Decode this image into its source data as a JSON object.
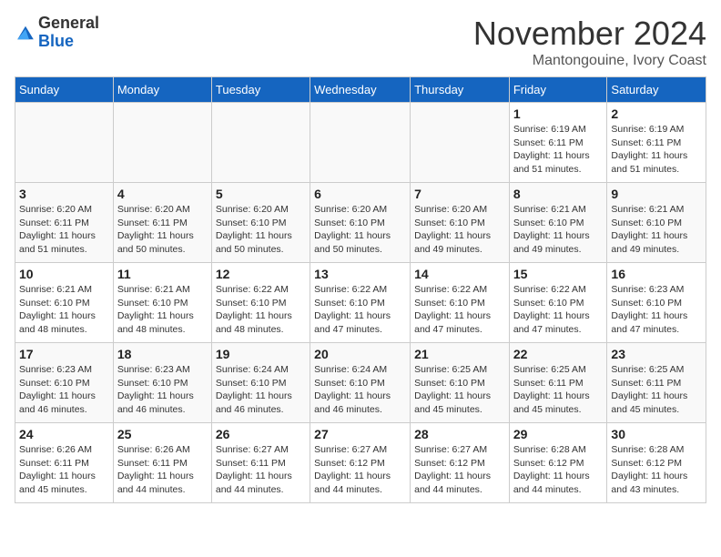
{
  "logo": {
    "general": "General",
    "blue": "Blue"
  },
  "title": "November 2024",
  "location": "Mantongouine, Ivory Coast",
  "weekdays": [
    "Sunday",
    "Monday",
    "Tuesday",
    "Wednesday",
    "Thursday",
    "Friday",
    "Saturday"
  ],
  "weeks": [
    [
      {
        "day": "",
        "info": ""
      },
      {
        "day": "",
        "info": ""
      },
      {
        "day": "",
        "info": ""
      },
      {
        "day": "",
        "info": ""
      },
      {
        "day": "",
        "info": ""
      },
      {
        "day": "1",
        "info": "Sunrise: 6:19 AM\nSunset: 6:11 PM\nDaylight: 11 hours and 51 minutes."
      },
      {
        "day": "2",
        "info": "Sunrise: 6:19 AM\nSunset: 6:11 PM\nDaylight: 11 hours and 51 minutes."
      }
    ],
    [
      {
        "day": "3",
        "info": "Sunrise: 6:20 AM\nSunset: 6:11 PM\nDaylight: 11 hours and 51 minutes."
      },
      {
        "day": "4",
        "info": "Sunrise: 6:20 AM\nSunset: 6:11 PM\nDaylight: 11 hours and 50 minutes."
      },
      {
        "day": "5",
        "info": "Sunrise: 6:20 AM\nSunset: 6:10 PM\nDaylight: 11 hours and 50 minutes."
      },
      {
        "day": "6",
        "info": "Sunrise: 6:20 AM\nSunset: 6:10 PM\nDaylight: 11 hours and 50 minutes."
      },
      {
        "day": "7",
        "info": "Sunrise: 6:20 AM\nSunset: 6:10 PM\nDaylight: 11 hours and 49 minutes."
      },
      {
        "day": "8",
        "info": "Sunrise: 6:21 AM\nSunset: 6:10 PM\nDaylight: 11 hours and 49 minutes."
      },
      {
        "day": "9",
        "info": "Sunrise: 6:21 AM\nSunset: 6:10 PM\nDaylight: 11 hours and 49 minutes."
      }
    ],
    [
      {
        "day": "10",
        "info": "Sunrise: 6:21 AM\nSunset: 6:10 PM\nDaylight: 11 hours and 48 minutes."
      },
      {
        "day": "11",
        "info": "Sunrise: 6:21 AM\nSunset: 6:10 PM\nDaylight: 11 hours and 48 minutes."
      },
      {
        "day": "12",
        "info": "Sunrise: 6:22 AM\nSunset: 6:10 PM\nDaylight: 11 hours and 48 minutes."
      },
      {
        "day": "13",
        "info": "Sunrise: 6:22 AM\nSunset: 6:10 PM\nDaylight: 11 hours and 47 minutes."
      },
      {
        "day": "14",
        "info": "Sunrise: 6:22 AM\nSunset: 6:10 PM\nDaylight: 11 hours and 47 minutes."
      },
      {
        "day": "15",
        "info": "Sunrise: 6:22 AM\nSunset: 6:10 PM\nDaylight: 11 hours and 47 minutes."
      },
      {
        "day": "16",
        "info": "Sunrise: 6:23 AM\nSunset: 6:10 PM\nDaylight: 11 hours and 47 minutes."
      }
    ],
    [
      {
        "day": "17",
        "info": "Sunrise: 6:23 AM\nSunset: 6:10 PM\nDaylight: 11 hours and 46 minutes."
      },
      {
        "day": "18",
        "info": "Sunrise: 6:23 AM\nSunset: 6:10 PM\nDaylight: 11 hours and 46 minutes."
      },
      {
        "day": "19",
        "info": "Sunrise: 6:24 AM\nSunset: 6:10 PM\nDaylight: 11 hours and 46 minutes."
      },
      {
        "day": "20",
        "info": "Sunrise: 6:24 AM\nSunset: 6:10 PM\nDaylight: 11 hours and 46 minutes."
      },
      {
        "day": "21",
        "info": "Sunrise: 6:25 AM\nSunset: 6:10 PM\nDaylight: 11 hours and 45 minutes."
      },
      {
        "day": "22",
        "info": "Sunrise: 6:25 AM\nSunset: 6:11 PM\nDaylight: 11 hours and 45 minutes."
      },
      {
        "day": "23",
        "info": "Sunrise: 6:25 AM\nSunset: 6:11 PM\nDaylight: 11 hours and 45 minutes."
      }
    ],
    [
      {
        "day": "24",
        "info": "Sunrise: 6:26 AM\nSunset: 6:11 PM\nDaylight: 11 hours and 45 minutes."
      },
      {
        "day": "25",
        "info": "Sunrise: 6:26 AM\nSunset: 6:11 PM\nDaylight: 11 hours and 44 minutes."
      },
      {
        "day": "26",
        "info": "Sunrise: 6:27 AM\nSunset: 6:11 PM\nDaylight: 11 hours and 44 minutes."
      },
      {
        "day": "27",
        "info": "Sunrise: 6:27 AM\nSunset: 6:12 PM\nDaylight: 11 hours and 44 minutes."
      },
      {
        "day": "28",
        "info": "Sunrise: 6:27 AM\nSunset: 6:12 PM\nDaylight: 11 hours and 44 minutes."
      },
      {
        "day": "29",
        "info": "Sunrise: 6:28 AM\nSunset: 6:12 PM\nDaylight: 11 hours and 44 minutes."
      },
      {
        "day": "30",
        "info": "Sunrise: 6:28 AM\nSunset: 6:12 PM\nDaylight: 11 hours and 43 minutes."
      }
    ]
  ]
}
